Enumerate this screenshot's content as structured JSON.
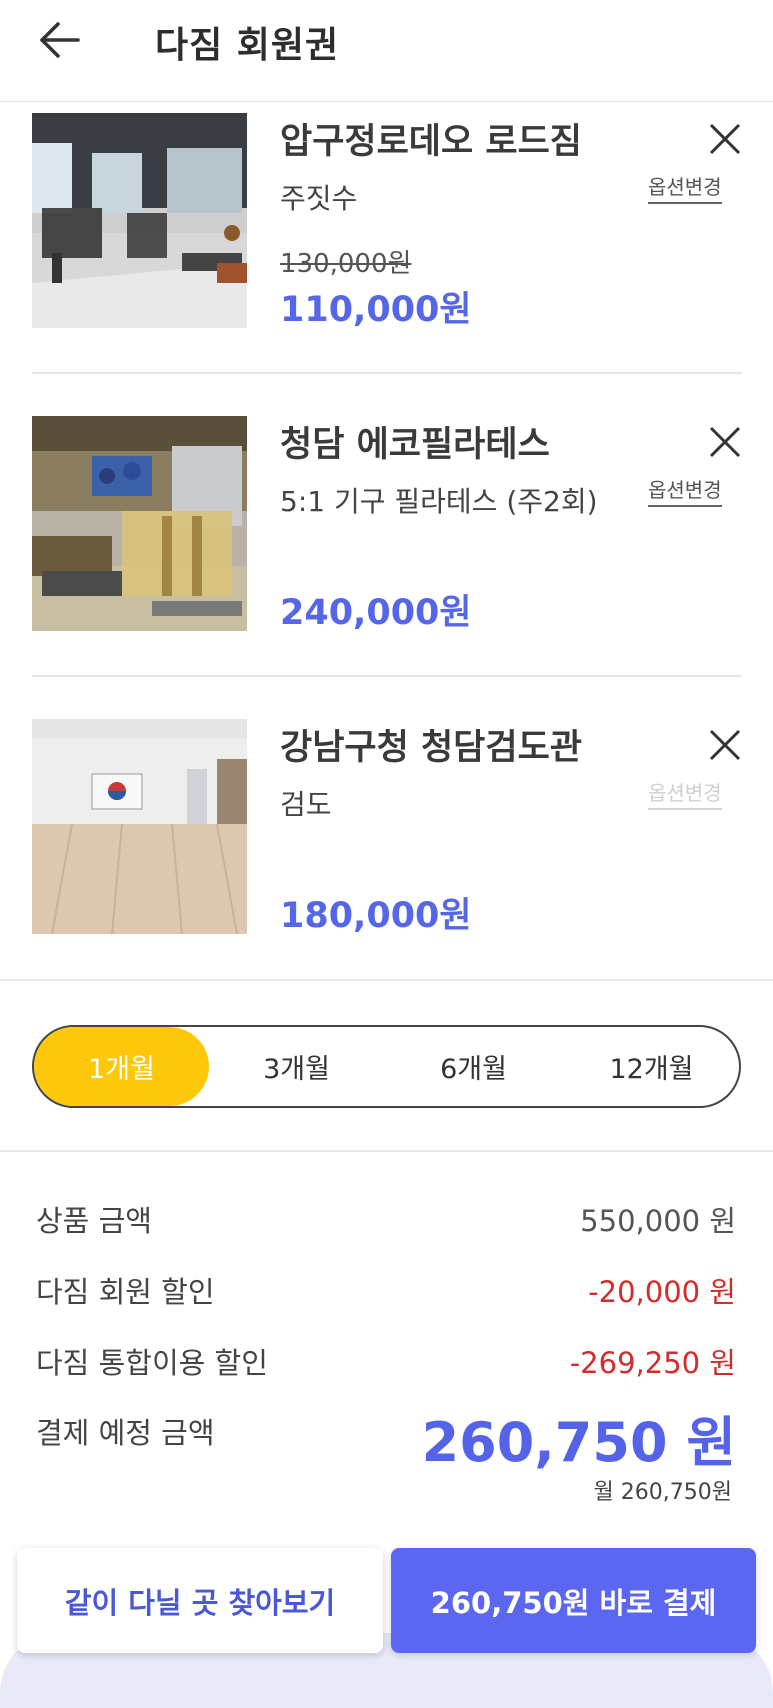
{
  "header": {
    "title": "다짐 회원권",
    "back_icon": "arrow-left-icon"
  },
  "items": [
    {
      "name": "압구정로데오 로드짐",
      "option": "주짓수",
      "original_price": "130,000원",
      "price": "110,000원",
      "option_change_label": "옵션변경",
      "option_change_enabled": true
    },
    {
      "name": "청담 에코필라테스",
      "option": "5:1 기구 필라테스 (주2회)",
      "original_price": "",
      "price": "240,000원",
      "option_change_label": "옵션변경",
      "option_change_enabled": true
    },
    {
      "name": "강남구청 청담검도관",
      "option": "검도",
      "original_price": "",
      "price": "180,000원",
      "option_change_label": "옵션변경",
      "option_change_enabled": false
    }
  ],
  "period": {
    "options": [
      "1개월",
      "3개월",
      "6개월",
      "12개월"
    ],
    "selected": "1개월"
  },
  "summary": {
    "product_amount_label": "상품 금액",
    "product_amount_value": "550,000 원",
    "member_discount_label": "다짐 회원 할인",
    "member_discount_value": "-20,000 원",
    "combined_discount_label": "다짐 통합이용 할인",
    "combined_discount_value": "-269,250 원",
    "total_label": "결제 예정 금액",
    "total_value": "260,750 원",
    "monthly": "월 260,750원"
  },
  "buttons": {
    "find_label": "같이 다닐 곳 찾아보기",
    "pay_label": "260,750원 바로 결제"
  },
  "colors": {
    "accent": "#5b67f0",
    "price": "#5566e6",
    "selected_period": "#fec80a",
    "discount": "#d42b2b"
  }
}
